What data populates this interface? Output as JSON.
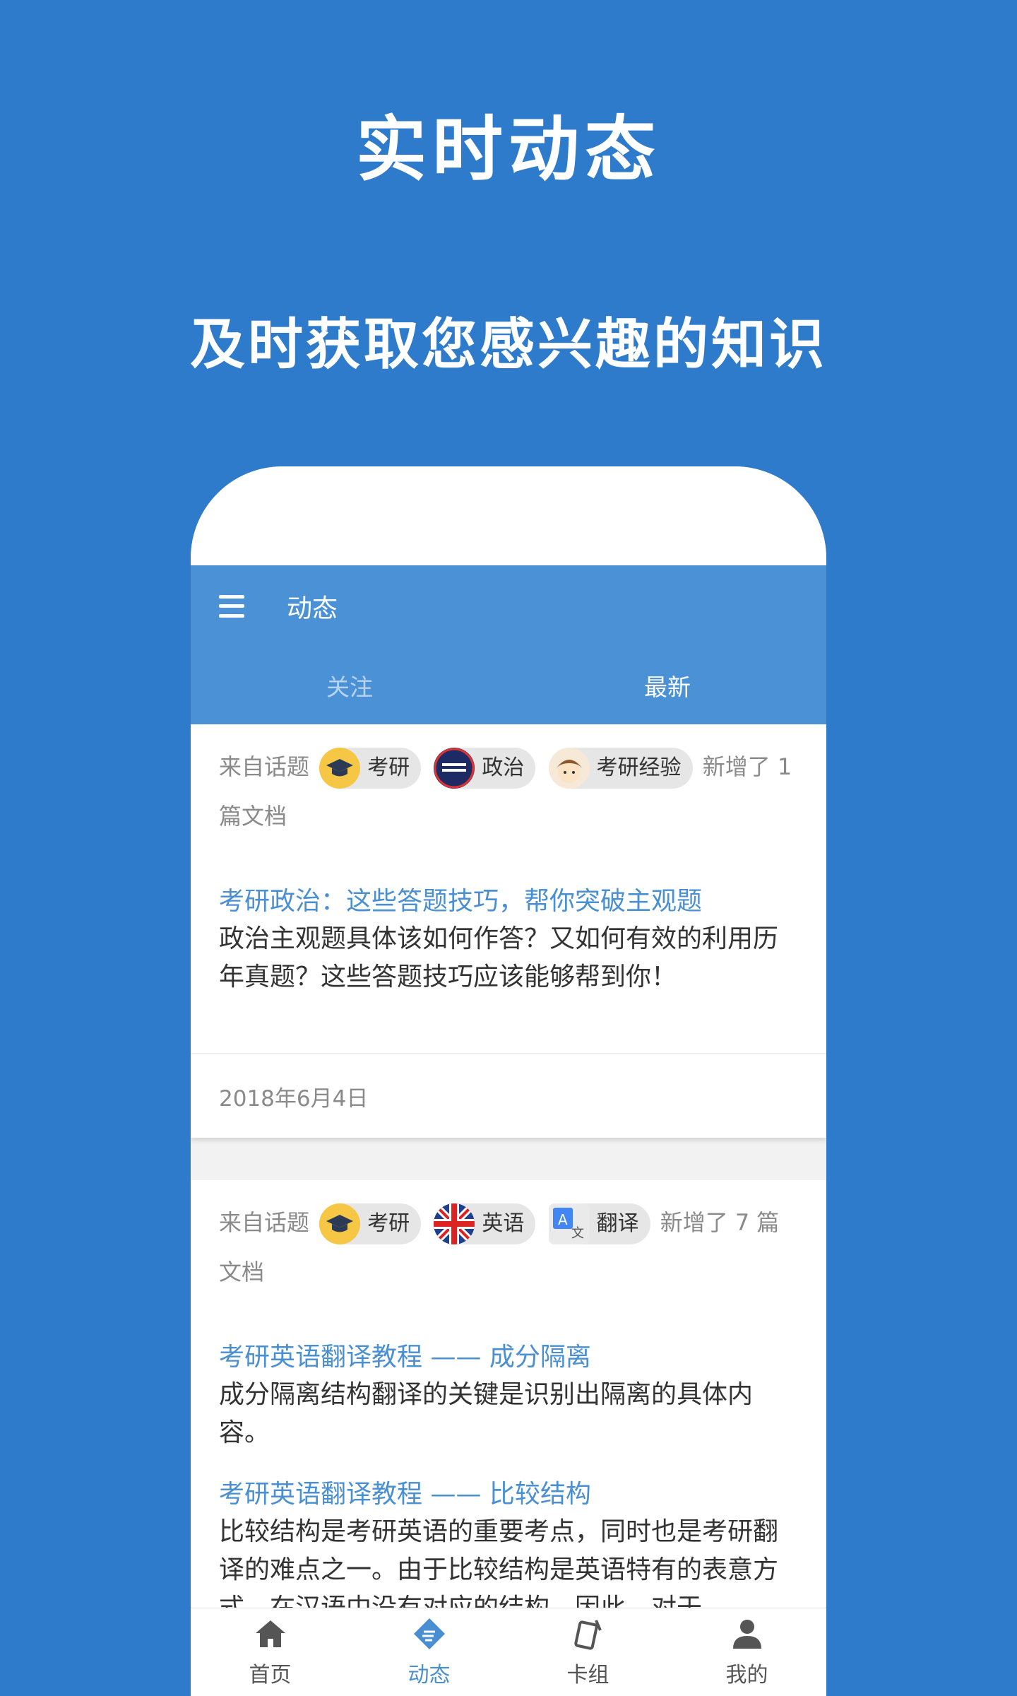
{
  "promo": {
    "title": "实时动态",
    "subtitle": "及时获取您感兴趣的知识"
  },
  "appbar": {
    "title": "动态",
    "menu_icon": "hamburger-menu-icon"
  },
  "tabs": [
    {
      "label": "关注",
      "active": false
    },
    {
      "label": "最新",
      "active": true
    }
  ],
  "feed": [
    {
      "prefix": "来自话题",
      "topics": [
        {
          "label": "考研",
          "icon": "graduation-cap-icon"
        },
        {
          "label": "政治",
          "icon": "politics-icon"
        },
        {
          "label": "考研经验",
          "icon": "cartoon-avatar-icon"
        }
      ],
      "suffix": "新增了 1 篇文档",
      "posts": [
        {
          "title": "考研政治：这些答题技巧，帮你突破主观题",
          "body": "政治主观题具体该如何作答？又如何有效的利用历年真题？这些答题技巧应该能够帮到你！"
        }
      ],
      "date": "2018年6月4日"
    },
    {
      "prefix": "来自话题",
      "topics": [
        {
          "label": "考研",
          "icon": "graduation-cap-icon"
        },
        {
          "label": "英语",
          "icon": "uk-flag-icon"
        },
        {
          "label": "翻译",
          "icon": "translate-icon"
        }
      ],
      "suffix": "新增了 7 篇文档",
      "posts": [
        {
          "title": "考研英语翻译教程 —— 成分隔离",
          "body": "成分隔离结构翻译的关键是识别出隔离的具体内容。"
        },
        {
          "title": "考研英语翻译教程 —— 比较结构",
          "body": "比较结构是考研英语的重要考点，同时也是考研翻译的难点之一。由于比较结构是英语特有的表意方式，在汉语中没有对应的结构，因此，对于"
        }
      ]
    }
  ],
  "bottom_nav": [
    {
      "label": "首页",
      "icon": "home-icon",
      "active": false
    },
    {
      "label": "动态",
      "icon": "feed-icon",
      "active": true
    },
    {
      "label": "卡组",
      "icon": "cards-icon",
      "active": false
    },
    {
      "label": "我的",
      "icon": "person-icon",
      "active": false
    }
  ],
  "colors": {
    "background": "#2f7bcb",
    "appbar": "#4b91d6",
    "link": "#4a8fd1"
  }
}
